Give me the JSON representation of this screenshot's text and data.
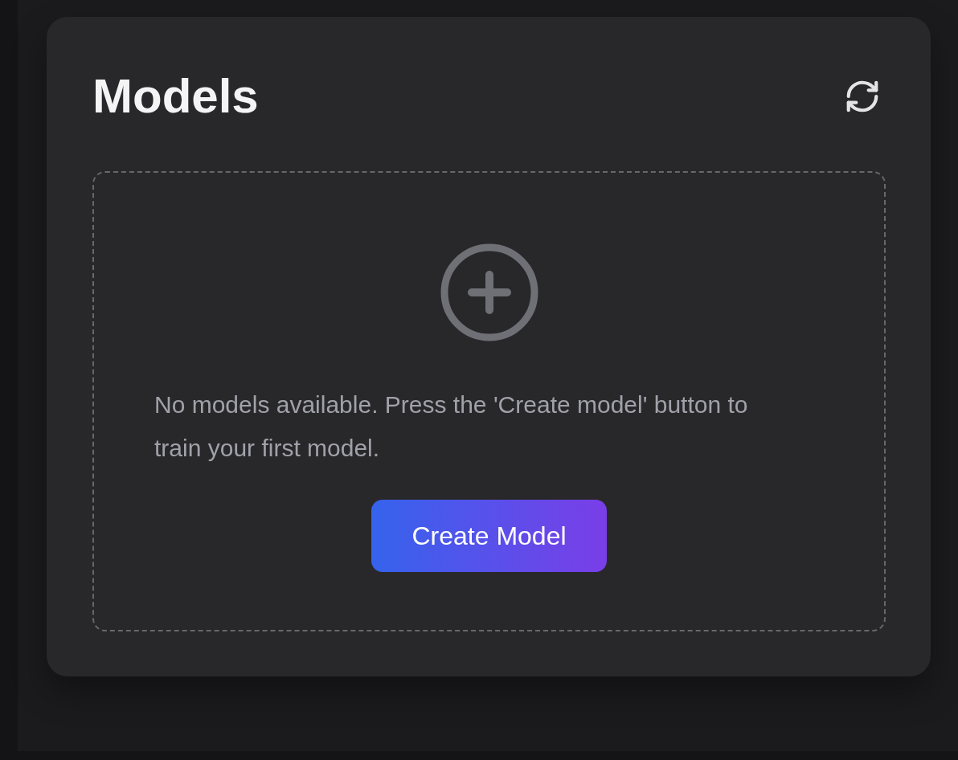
{
  "panel": {
    "title": "Models"
  },
  "empty_state": {
    "message": "No models available. Press the 'Create model' button to train your first model.",
    "button": "Create Model"
  }
}
